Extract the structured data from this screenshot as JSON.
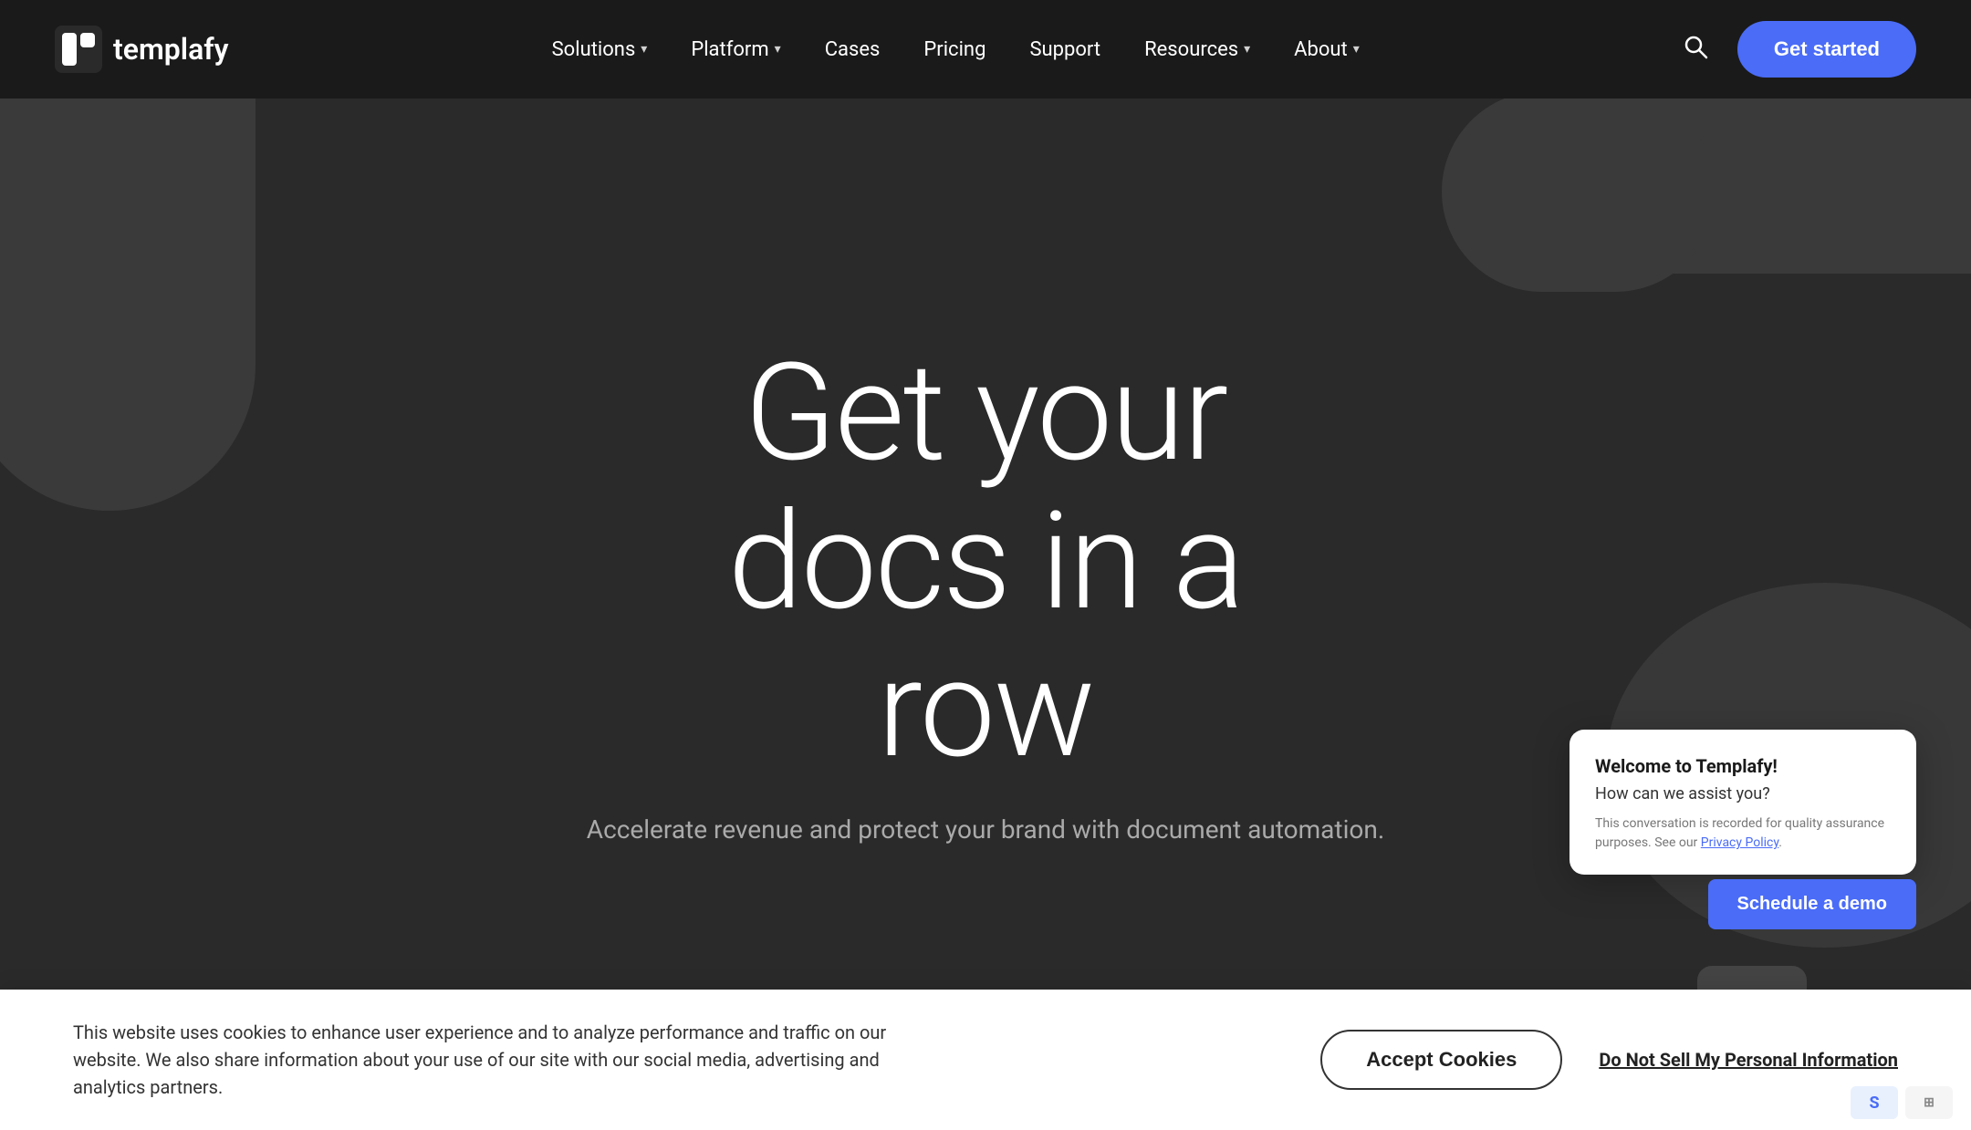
{
  "navbar": {
    "logo_text": "templafy",
    "nav_items": [
      {
        "label": "Solutions",
        "has_chevron": true
      },
      {
        "label": "Platform",
        "has_chevron": true
      },
      {
        "label": "Cases",
        "has_chevron": false
      },
      {
        "label": "Pricing",
        "has_chevron": false
      },
      {
        "label": "Support",
        "has_chevron": false
      },
      {
        "label": "Resources",
        "has_chevron": true
      },
      {
        "label": "About",
        "has_chevron": true
      }
    ],
    "get_started_label": "Get started"
  },
  "hero": {
    "title_line1": "Get your",
    "title_line2": "docs in a",
    "title_line3": "row",
    "subtitle": "Accelerate revenue and protect your brand with document automation."
  },
  "chat_widget": {
    "title": "Welcome to Templafy!",
    "subtitle": "How can we assist you?",
    "legal_text": "This conversation is recorded for quality assurance purposes. See our",
    "privacy_link": "Privacy Policy",
    "schedule_label": "Schedule a demo"
  },
  "cookie_banner": {
    "text": "This website uses cookies to enhance user experience and to analyze performance and traffic on our website. We also share information about your use of our site with our social media, advertising and analytics partners.",
    "accept_label": "Accept Cookies",
    "do_not_sell_label": "Do Not Sell My Personal Information"
  }
}
